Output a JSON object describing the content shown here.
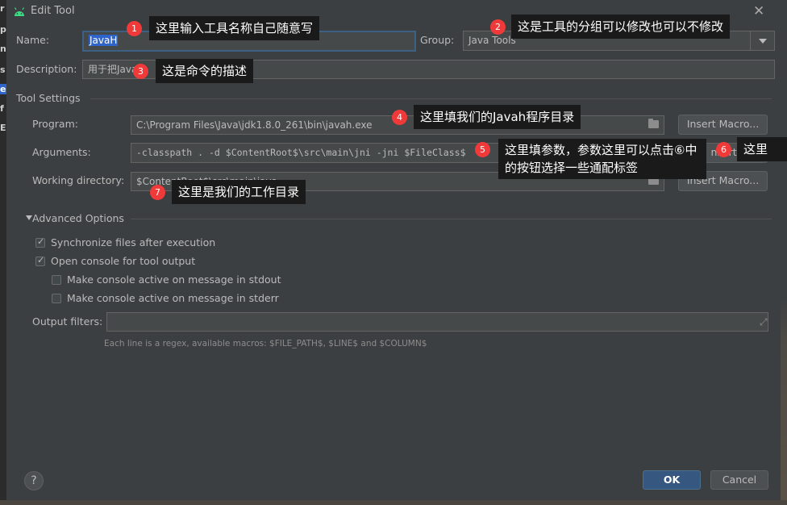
{
  "window": {
    "title": "Edit Tool"
  },
  "left_edge_glyphs": [
    "r",
    "p",
    "n",
    "s",
    "e",
    "f",
    "E"
  ],
  "form": {
    "name_label": "Name:",
    "name_value": "JavaH",
    "group_label": "Group:",
    "group_value": "Java Tools",
    "description_label": "Description:",
    "description_value": "用于把Java"
  },
  "tool_settings": {
    "section_title": "Tool Settings",
    "program_label": "Program:",
    "program_value": "C:\\Program Files\\Java\\jdk1.8.0_261\\bin\\javah.exe",
    "arguments_label": "Arguments:",
    "arguments_value": "-classpath . -d $ContentRoot$\\src\\main\\jni -jni $FileClass$",
    "working_dir_label": "Working directory:",
    "working_dir_value": "$ContentRoot$\\src\\main\\java",
    "insert_macro_label": "Insert Macro...",
    "insert_macro_partial": "nsert Mac"
  },
  "advanced": {
    "section_title": "Advanced Options",
    "options": [
      {
        "label": "Synchronize files after execution",
        "checked": true
      },
      {
        "label": "Open console for tool output",
        "checked": true
      },
      {
        "label": "Make console active on message in stdout",
        "checked": false
      },
      {
        "label": "Make console active on message in stderr",
        "checked": false
      }
    ],
    "output_filters_label": "Output filters:",
    "output_filters_value": "",
    "hint": "Each line is a regex, available macros: $FILE_PATH$, $LINE$ and $COLUMN$"
  },
  "buttons": {
    "help": "?",
    "ok": "OK",
    "cancel": "Cancel"
  },
  "annotations": [
    {
      "number": "1",
      "text": "这里输入工具名称自己随意写"
    },
    {
      "number": "2",
      "text": "这是工具的分组可以修改也可以不修改"
    },
    {
      "number": "3",
      "text": "这是命令的描述"
    },
    {
      "number": "4",
      "text": "这里填我们的Javah程序目录"
    },
    {
      "number": "5",
      "text": "这里填参数，参数这里可以点击⑥中的按钮选择一些通配标签"
    },
    {
      "number": "6",
      "text": "这里"
    },
    {
      "number": "7",
      "text": "这里是我们的工作目录"
    }
  ],
  "colors": {
    "badge": "#f03a3a",
    "note_bg": "#1a1a1a",
    "dialog_bg": "#3c3f41",
    "ok_button": "#365880"
  }
}
